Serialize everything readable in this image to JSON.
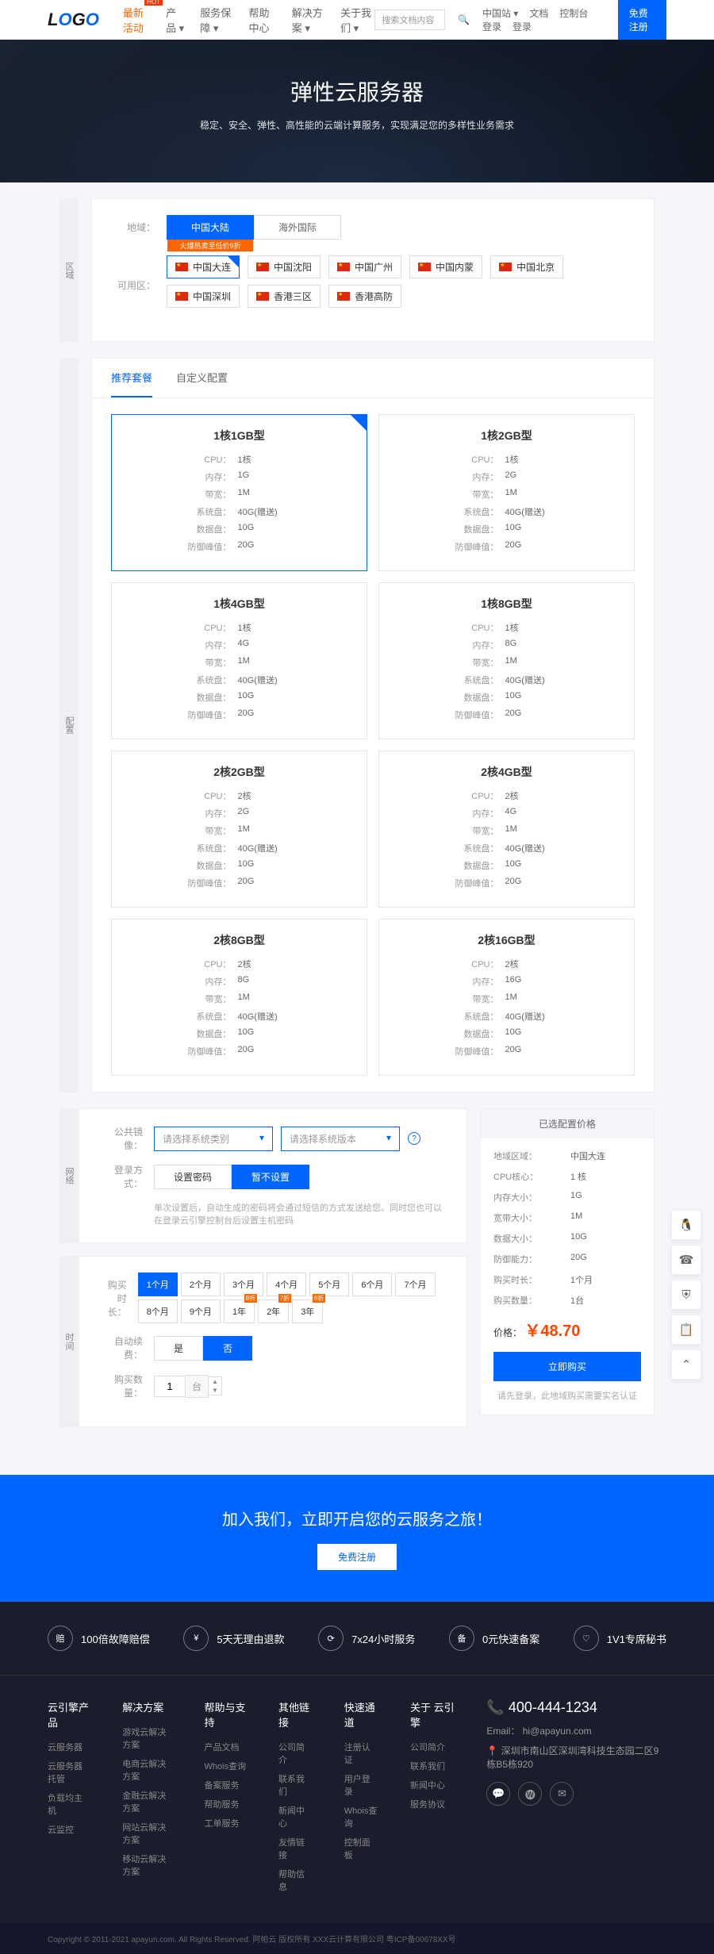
{
  "header": {
    "nav": [
      "最新活动",
      "产品 ▾",
      "服务保障 ▾",
      "帮助中心",
      "解决方案 ▾",
      "关于我们 ▾"
    ],
    "search": "搜索文档内容",
    "right": [
      "中国站 ▾",
      "文档",
      "控制台",
      "登录",
      "登录"
    ],
    "reg": "免费注册"
  },
  "hero": {
    "title": "弹性云服务器",
    "sub": "稳定、安全、弹性、高性能的云端计算服务，实现满足您的多样性业务需求"
  },
  "area": {
    "label1": "地域：",
    "tabs": [
      "中国大陆",
      "海外国际"
    ],
    "tabSub": "火爆热卖至低价9折",
    "label2": "可用区：",
    "regions": [
      "中国大连",
      "中国沈阳",
      "中国广州",
      "中国内蒙",
      "中国北京",
      "中国深圳",
      "香港三区",
      "香港高防"
    ]
  },
  "cfg": {
    "tabs": [
      "推荐套餐",
      "自定义配置"
    ],
    "specs": [
      {
        "t": "CPU：",
        "k": "cpu"
      },
      {
        "t": "内存：",
        "k": "mem"
      },
      {
        "t": "带宽：",
        "k": "bw"
      },
      {
        "t": "系统盘：",
        "k": "sys"
      },
      {
        "t": "数据盘：",
        "k": "data"
      },
      {
        "t": "防御峰值：",
        "k": "def"
      }
    ],
    "packages": [
      {
        "name": "1核1GB型",
        "cpu": "1核",
        "mem": "1G",
        "bw": "1M",
        "sys": "40G(赠送)",
        "data": "10G",
        "def": "20G"
      },
      {
        "name": "1核2GB型",
        "cpu": "1核",
        "mem": "2G",
        "bw": "1M",
        "sys": "40G(赠送)",
        "data": "10G",
        "def": "20G"
      },
      {
        "name": "1核4GB型",
        "cpu": "1核",
        "mem": "4G",
        "bw": "1M",
        "sys": "40G(赠送)",
        "data": "10G",
        "def": "20G"
      },
      {
        "name": "1核8GB型",
        "cpu": "1核",
        "mem": "8G",
        "bw": "1M",
        "sys": "40G(赠送)",
        "data": "10G",
        "def": "20G"
      },
      {
        "name": "2核2GB型",
        "cpu": "2核",
        "mem": "2G",
        "bw": "1M",
        "sys": "40G(赠送)",
        "data": "10G",
        "def": "20G"
      },
      {
        "name": "2核4GB型",
        "cpu": "2核",
        "mem": "4G",
        "bw": "1M",
        "sys": "40G(赠送)",
        "data": "10G",
        "def": "20G"
      },
      {
        "name": "2核8GB型",
        "cpu": "2核",
        "mem": "8G",
        "bw": "1M",
        "sys": "40G(赠送)",
        "data": "10G",
        "def": "20G"
      },
      {
        "name": "2核16GB型",
        "cpu": "2核",
        "mem": "16G",
        "bw": "1M",
        "sys": "40G(赠送)",
        "data": "10G",
        "def": "20G"
      }
    ]
  },
  "mirror": {
    "label": "公共镜像：",
    "sel1": "请选择系统类别",
    "sel2": "请选择系统版本",
    "help": "?"
  },
  "login": {
    "label": "登录方式：",
    "opts": [
      "设置密码",
      "暂不设置"
    ],
    "hint": "单次设置后，自动生成的密码将会通过短信的方式发送给您。同时您也可以在登录云引擎控制台后设置主机密码"
  },
  "time": {
    "label1": "购买时长：",
    "durs": [
      "1个月",
      "2个月",
      "3个月",
      "4个月",
      "5个月",
      "6个月",
      "7个月",
      "8个月",
      "9个月",
      "1年",
      "2年",
      "3年"
    ],
    "badges": {
      "9": "8折",
      "10": "7折",
      "11": "6折"
    },
    "label2": "自动续费：",
    "auto": [
      "是",
      "否"
    ],
    "label3": "购买数量：",
    "qty": "1",
    "unit": "台"
  },
  "price": {
    "title": "已选配置价格",
    "rows": [
      [
        "地域区域：",
        "中国大连"
      ],
      [
        "CPU核心：",
        "1 核"
      ],
      [
        "内存大小：",
        "1G"
      ],
      [
        "宽带大小：",
        "1M"
      ],
      [
        "数据大小：",
        "10G"
      ],
      [
        "防御能力：",
        "20G"
      ],
      [
        "购买时长：",
        "1个月"
      ],
      [
        "购买数量：",
        "1台"
      ]
    ],
    "plabel": "价格：",
    "amount": "￥48.70",
    "buy": "立即购买",
    "note": "请先登录，此地域购买需要实名认证"
  },
  "cta": {
    "title": "加入我们，立即开启您的云服务之旅！",
    "btn": "免费注册"
  },
  "feats": [
    [
      "赔",
      "100倍故障赔偿"
    ],
    [
      "¥",
      "5天无理由退款"
    ],
    [
      "⟳",
      "7x24小时服务"
    ],
    [
      "备",
      "0元快速备案"
    ],
    [
      "♡",
      "1V1专席秘书"
    ]
  ],
  "footer": {
    "cols": [
      {
        "h": "云引擎产品",
        "l": [
          "云服务器",
          "云服务器托管",
          "负载均主机",
          "云监控"
        ]
      },
      {
        "h": "解决方案",
        "l": [
          "游戏云解决方案",
          "电商云解决方案",
          "金融云解决方案",
          "网站云解决方案",
          "移动云解决方案"
        ]
      },
      {
        "h": "帮助与支持",
        "l": [
          "产品文档",
          "Whois查询",
          "备案服务",
          "帮助服务",
          "工单服务"
        ]
      },
      {
        "h": "其他链接",
        "l": [
          "公司简介",
          "联系我们",
          "新闻中心",
          "友情链接",
          "帮助信息"
        ]
      },
      {
        "h": "快速通道",
        "l": [
          "注册认证",
          "用户登录",
          "Whois查询",
          "控制面板"
        ]
      },
      {
        "h": "关于 云引擎",
        "l": [
          "公司简介",
          "联系我们",
          "新闻中心",
          "服务协议"
        ]
      }
    ],
    "phone": "400-444-1234",
    "email": "Email： hi@apayun.com",
    "addr": "深圳市南山区深圳湾科技生态园二区9栋B5栋920"
  },
  "copy": "Copyright © 2011-2021 apayun.com. All Rights Reserved. 阿帕云 版权所有   XXX云计算有限公司   粤ICP备00678XX号",
  "sides": [
    "区域",
    "配置",
    "网络",
    "时间"
  ]
}
